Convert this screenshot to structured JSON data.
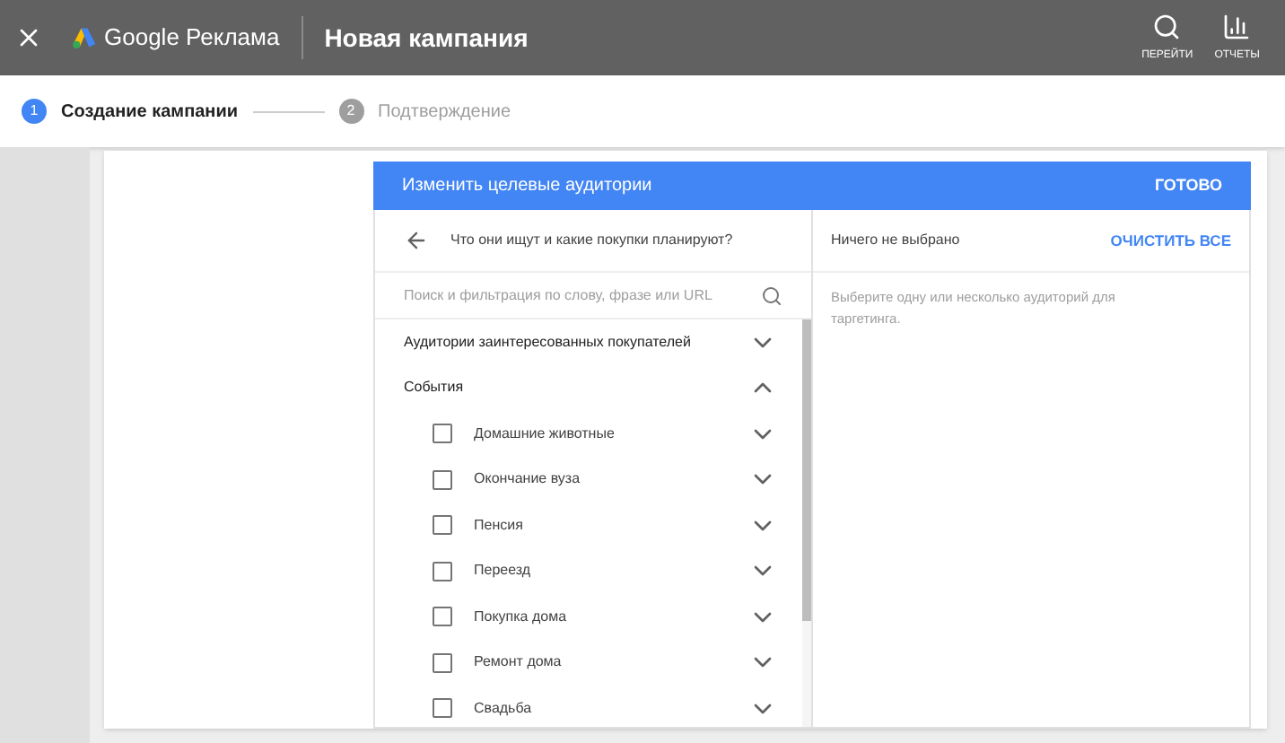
{
  "app_bar": {
    "product": "Google Реклама",
    "title": "Новая кампания",
    "actions": [
      {
        "kind": "search",
        "label": "ПЕРЕЙТИ"
      },
      {
        "kind": "reports",
        "label": "ОТЧЕТЫ"
      }
    ]
  },
  "stepper": [
    {
      "number": "1",
      "label": "Создание кампании",
      "selected": true
    },
    {
      "number": "2",
      "label": "Подтверждение",
      "selected": false
    }
  ],
  "dialog": {
    "title": "Изменить целевые аудитории",
    "done": "ГОТОВО",
    "browse": {
      "heading": "Что они ищут и какие покупки планируют?",
      "search": {
        "placeholder": "Поиск и фильтрация по слову, фразе или URL"
      },
      "categories": [
        {
          "label": "Аудитории заинтересованных покупателей",
          "expanded": false
        },
        {
          "label": "События",
          "expanded": true,
          "children": [
            {
              "label": "Домашние животные",
              "checked": false
            },
            {
              "label": "Окончание вуза",
              "checked": false
            },
            {
              "label": "Пенсия",
              "checked": false
            },
            {
              "label": "Переезд",
              "checked": false
            },
            {
              "label": "Покупка дома",
              "checked": false
            },
            {
              "label": "Ремонт дома",
              "checked": false
            },
            {
              "label": "Свадьба",
              "checked": false
            }
          ]
        }
      ]
    },
    "selection": {
      "status": "Ничего не выбрано",
      "clear": "ОЧИСТИТЬ ВСЕ",
      "hint": "Выберите одну или несколько аудиторий для таргетинга."
    }
  }
}
